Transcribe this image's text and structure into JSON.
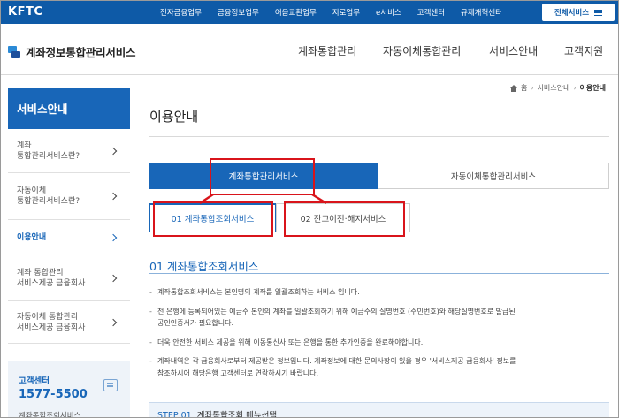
{
  "topbar": {
    "brand": "KFTC",
    "links": [
      "전자금융업무",
      "금융정보업무",
      "어음교환업무",
      "지로업무",
      "e서비스",
      "고객센터",
      "규제개혁센터"
    ],
    "all_services": "전체서비스"
  },
  "header": {
    "logo_text": "계좌정보통합관리서비스",
    "gnb": [
      "계좌통합관리",
      "자동이체통합관리",
      "서비스안내",
      "고객지원"
    ]
  },
  "breadcrumb": {
    "home": "홈",
    "parent": "서비스안내",
    "current": "이용안내"
  },
  "sidebar": {
    "title": "서비스안내",
    "items": [
      {
        "line1": "계좌",
        "line2": "통합관리서비스란?",
        "active": false
      },
      {
        "line1": "자동이체",
        "line2": "통합관리서비스란?",
        "active": false
      },
      {
        "line1": "이용안내",
        "line2": "",
        "active": true
      },
      {
        "line1": "계좌 통합관리",
        "line2": "서비스제공 금융회사",
        "active": false
      },
      {
        "line1": "자동이체 통합관리",
        "line2": "서비스제공 금융회사",
        "active": false
      }
    ],
    "callcenter": {
      "label": "고객센터",
      "number": "1577-5500",
      "sub": "계좌통합조회서비스"
    }
  },
  "main": {
    "title": "이용안내",
    "tabs": [
      "계좌통합관리서비스",
      "자동이체통합관리서비스"
    ],
    "subtabs": [
      "01 계좌통합조회서비스",
      "02 잔고이전·해지서비스"
    ],
    "section_title": "01 계좌통합조회서비스",
    "bullets": [
      [
        "계좌통합조회서비스는 본인명의 계좌를 일괄조회하는 서비스 입니다."
      ],
      [
        "전 은행에 등록되어있는 예금주 본인의 계좌를 일괄조회하기 위해 예금주의 실명번호 (주민번호)와 해당실명번호로 발급된",
        "공인인증서가 필요합니다."
      ],
      [
        "더욱 안전한 서비스 제공을 위해 이동통신사 또는 은행을 통한 추가인증을 완료해야합니다."
      ],
      [
        "계좌내역은 각 금융회사로부터 제공받은 정보입니다. 계좌정보에 대한 문의사항이 있을 경우 '서비스제공 금융회사' 정보를",
        "참조하시어 해당은행 고객센터로 연락하시기 바랍니다."
      ]
    ],
    "step": {
      "label": "STEP 01",
      "name": "계좌통합조회 메뉴선택"
    }
  },
  "colors": {
    "brand_blue": "#0e5aa7",
    "accent_blue": "#1866b8",
    "highlight_red": "#d9141b"
  }
}
